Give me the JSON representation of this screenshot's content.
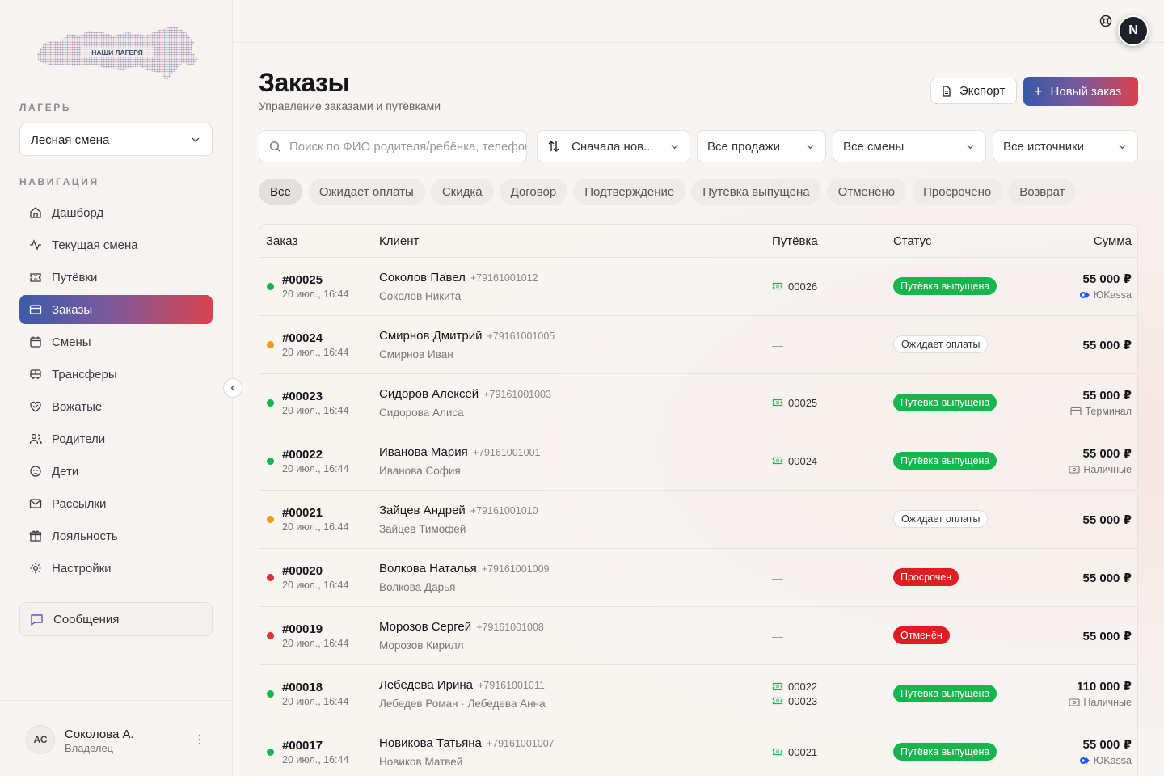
{
  "brand": {
    "logo_text": "НАШИ ЛАГЕРЯ"
  },
  "sidebar": {
    "camp_label": "ЛАГЕРЬ",
    "camp_value": "Лесная смена",
    "nav_label": "НАВИГАЦИЯ",
    "items": [
      {
        "label": "Дашборд",
        "icon": "home-icon"
      },
      {
        "label": "Текущая смена",
        "icon": "activity-icon"
      },
      {
        "label": "Путёвки",
        "icon": "ticket-icon"
      },
      {
        "label": "Заказы",
        "icon": "card-icon",
        "active": true
      },
      {
        "label": "Смены",
        "icon": "calendar-icon"
      },
      {
        "label": "Трансферы",
        "icon": "bus-icon"
      },
      {
        "label": "Вожатые",
        "icon": "heart-handshake-icon"
      },
      {
        "label": "Родители",
        "icon": "users-icon"
      },
      {
        "label": "Дети",
        "icon": "baby-icon"
      },
      {
        "label": "Рассылки",
        "icon": "mail-icon"
      },
      {
        "label": "Лояльность",
        "icon": "gift-icon"
      },
      {
        "label": "Настройки",
        "icon": "gear-icon"
      }
    ],
    "messages_label": "Сообщения",
    "user": {
      "initials": "АС",
      "name": "Соколова А.",
      "role": "Владелец"
    }
  },
  "topbar": {
    "avatar_initial": "N"
  },
  "page": {
    "title": "Заказы",
    "subtitle": "Управление заказами и путёвками",
    "export_label": "Экспорт",
    "new_order_label": "Новый заказ"
  },
  "filters": {
    "search_placeholder": "Поиск по ФИО родителя/ребёнка, телефону",
    "sort": "Сначала нов...",
    "sales": "Все продажи",
    "shifts": "Все смены",
    "sources": "Все источники"
  },
  "chips": [
    "Все",
    "Ожидает оплаты",
    "Скидка",
    "Договор",
    "Подтверждение",
    "Путёвка выпущена",
    "Отменено",
    "Просрочено",
    "Возврат"
  ],
  "table": {
    "headers": {
      "order": "Заказ",
      "client": "Клиент",
      "voucher": "Путёвка",
      "status": "Статус",
      "amount": "Сумма"
    },
    "rows": [
      {
        "id": "#00025",
        "date": "20 июл., 16:44",
        "dot": "#17b54e",
        "client": "Соколов Павел",
        "phone": "+79161001012",
        "kids": "Соколов Никита",
        "vouchers": [
          "00026"
        ],
        "status": "Путёвка выпущена",
        "status_type": "green",
        "amount": "55 000 ₽",
        "payment": "ЮKassa",
        "payment_icon": "yookassa-icon"
      },
      {
        "id": "#00024",
        "date": "20 июл., 16:44",
        "dot": "#f29a13",
        "client": "Смирнов Дмитрий",
        "phone": "+79161001005",
        "kids": "Смирнов Иван",
        "vouchers": [],
        "status": "Ожидает оплаты",
        "status_type": "outline",
        "amount": "55 000 ₽",
        "payment": ""
      },
      {
        "id": "#00023",
        "date": "20 июл., 16:44",
        "dot": "#17b54e",
        "client": "Сидоров Алексей",
        "phone": "+79161001003",
        "kids": "Сидорова Алиса",
        "vouchers": [
          "00025"
        ],
        "status": "Путёвка выпущена",
        "status_type": "green",
        "amount": "55 000 ₽",
        "payment": "Терминал",
        "payment_icon": "terminal-card-icon"
      },
      {
        "id": "#00022",
        "date": "20 июл., 16:44",
        "dot": "#17b54e",
        "client": "Иванова Мария",
        "phone": "+79161001001",
        "kids": "Иванова София",
        "vouchers": [
          "00024"
        ],
        "status": "Путёвка выпущена",
        "status_type": "green",
        "amount": "55 000 ₽",
        "payment": "Наличные",
        "payment_icon": "cash-icon"
      },
      {
        "id": "#00021",
        "date": "20 июл., 16:44",
        "dot": "#f29a13",
        "client": "Зайцев Андрей",
        "phone": "+79161001010",
        "kids": "Зайцев Тимофей",
        "vouchers": [],
        "status": "Ожидает оплаты",
        "status_type": "outline",
        "amount": "55 000 ₽",
        "payment": ""
      },
      {
        "id": "#00020",
        "date": "20 июл., 16:44",
        "dot": "#e0302f",
        "client": "Волкова Наталья",
        "phone": "+79161001009",
        "kids": "Волкова Дарья",
        "vouchers": [],
        "status": "Просрочен",
        "status_type": "red",
        "amount": "55 000 ₽",
        "payment": ""
      },
      {
        "id": "#00019",
        "date": "20 июл., 16:44",
        "dot": "#e0302f",
        "client": "Морозов Сергей",
        "phone": "+79161001008",
        "kids": "Морозов Кирилл",
        "vouchers": [],
        "status": "Отменён",
        "status_type": "red",
        "amount": "55 000 ₽",
        "payment": ""
      },
      {
        "id": "#00018",
        "date": "20 июл., 16:44",
        "dot": "#17b54e",
        "client": "Лебедева Ирина",
        "phone": "+79161001011",
        "kids": "Лебедев Роман · Лебедева Анна",
        "vouchers": [
          "00022",
          "00023"
        ],
        "status": "Путёвка выпущена",
        "status_type": "green",
        "amount": "110 000 ₽",
        "payment": "Наличные",
        "payment_icon": "cash-icon"
      },
      {
        "id": "#00017",
        "date": "20 июл., 16:44",
        "dot": "#17b54e",
        "client": "Новикова Татьяна",
        "phone": "+79161001007",
        "kids": "Новиков Матвей",
        "vouchers": [
          "00021"
        ],
        "status": "Путёвка выпущена",
        "status_type": "green",
        "amount": "55 000 ₽",
        "payment": "ЮKassa",
        "payment_icon": "yookassa-icon"
      }
    ]
  },
  "colors": {
    "accent_start": "#3b5ba8",
    "accent_end": "#d8444f",
    "success": "#17b54e",
    "danger": "#e11d22",
    "pending": "#f29a13"
  }
}
